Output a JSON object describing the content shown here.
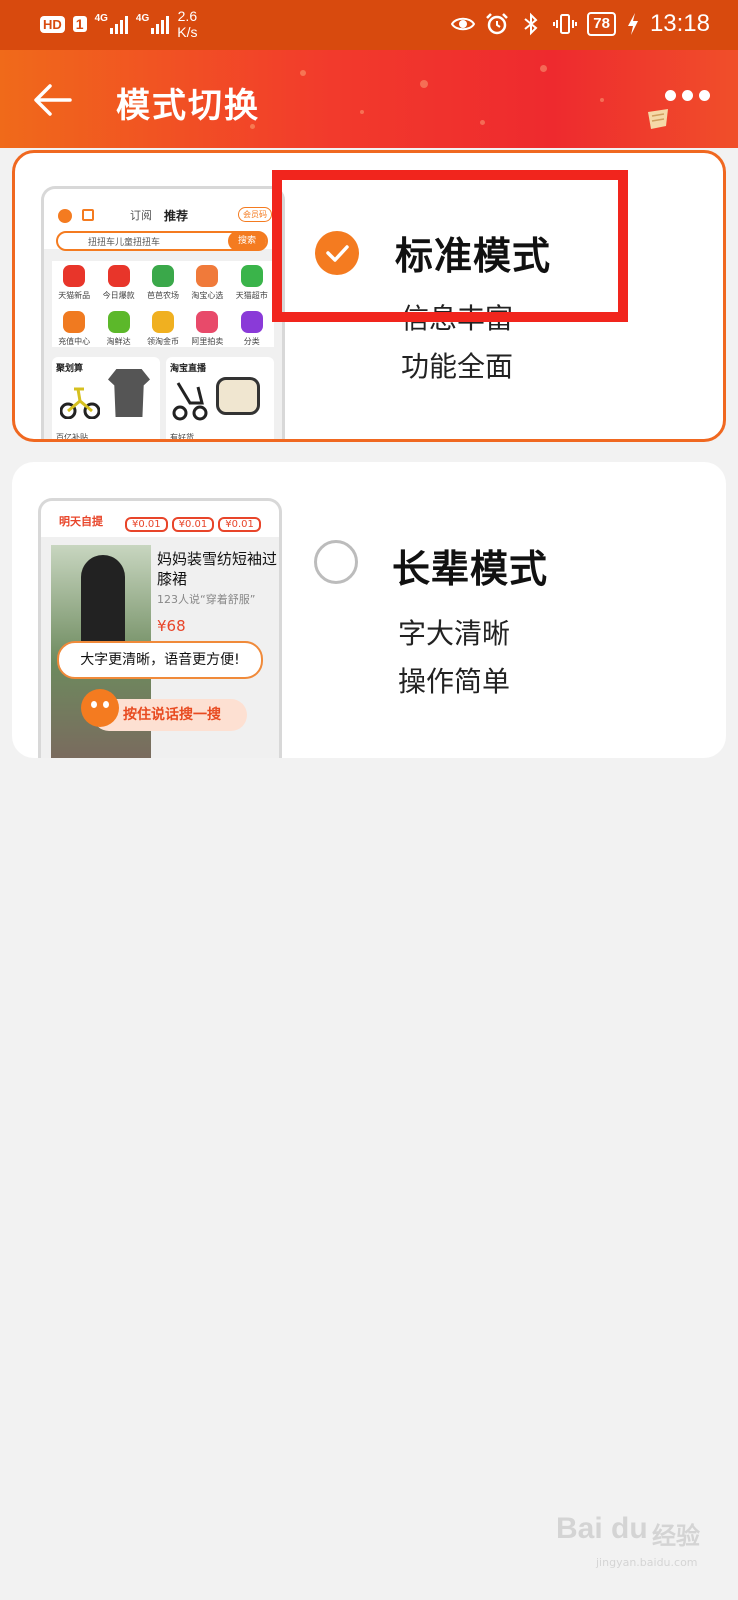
{
  "status_bar": {
    "hd": "HD",
    "sim": "1",
    "net1": "4G",
    "net2": "4G",
    "speed_value": "2.6",
    "speed_unit": "K/s",
    "battery": "78",
    "time": "13:18"
  },
  "header": {
    "title": "模式切换",
    "back_icon": "arrow-left-icon",
    "more_icon": "more-dots-icon"
  },
  "modes": [
    {
      "title": "标准模式",
      "selected": true,
      "desc1": "信息丰富",
      "desc2": "功能全面"
    },
    {
      "title": "长辈模式",
      "selected": false,
      "desc1": "字大清晰",
      "desc2": "操作简单"
    }
  ],
  "preview_standard": {
    "tab1": "订阅",
    "tab2": "推荐",
    "tab_badge": "会员日",
    "member": "会员码",
    "search_text": "扭扭车儿童扭扭车",
    "search_btn": "搜索",
    "grid": [
      {
        "label": "天猫新品",
        "color": "#e8352a"
      },
      {
        "label": "今日爆款",
        "color": "#e8352a"
      },
      {
        "label": "芭芭农场",
        "color": "#3aa84a"
      },
      {
        "label": "淘宝心选",
        "color": "#f07a3a"
      },
      {
        "label": "天猫超市",
        "color": "#3ab44a"
      },
      {
        "label": "充值中心",
        "color": "#f07a20"
      },
      {
        "label": "淘鲜达",
        "color": "#5cb82a"
      },
      {
        "label": "领淘金币",
        "color": "#f0b020"
      },
      {
        "label": "阿里拍卖",
        "color": "#e84a6a"
      },
      {
        "label": "分类",
        "color": "#8a3ad8"
      }
    ],
    "section1": "聚划算",
    "section1_foot": "百亿补贴",
    "section2": "淘宝直播",
    "section2_foot": "有好货"
  },
  "preview_elder": {
    "header_label": "明天自提",
    "prices": [
      "¥0.01",
      "¥0.01",
      "¥0.01"
    ],
    "product_title": "妈妈装雪纺短袖过膝裙",
    "product_sub": "123人说“穿着舒服”",
    "price": "¥68",
    "bubble": "大字更清晰，语音更方便!",
    "mic": "按住说话搜一搜"
  },
  "watermark": {
    "logo": "Bai du",
    "text": "经验",
    "url": "jingyan.baidu.com"
  },
  "colors": {
    "accent": "#f47b20",
    "highlight": "#f1251d",
    "statusbar": "#d84a0e"
  }
}
